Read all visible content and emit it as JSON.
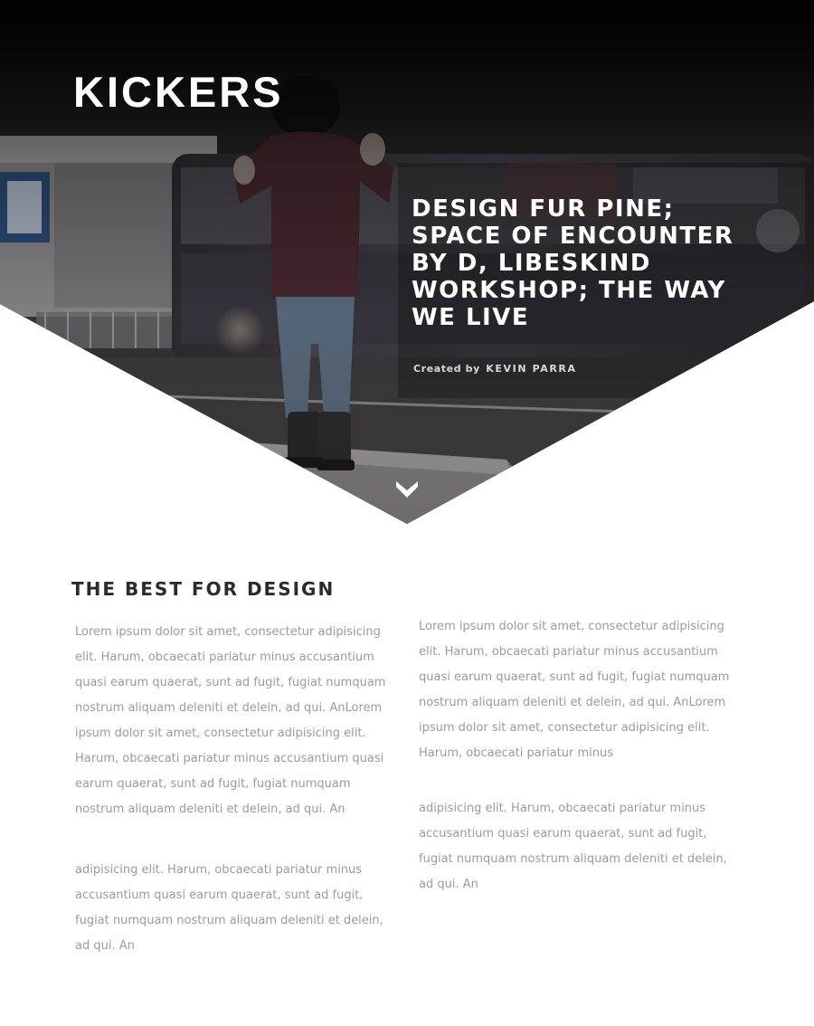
{
  "hero": {
    "brand": "KICKERS",
    "headline": "DESIGN FUR PINE; SPACE OF ENCOUNTER BY D, LIBESKIND WORKSHOP; THE WAY WE LIVE",
    "credit_prefix": "Created by",
    "credit_author": "KEVIN PARRA",
    "scroll_icon": "chevron-down-icon"
  },
  "section": {
    "title": "THE BEST FOR DESIGN",
    "left_column": [
      "Lorem ipsum dolor sit amet, consectetur adipisicing elit. Harum, obcaecati pariatur minus accusantium quasi earum quaerat, sunt ad fugit, fugiat numquam nostrum aliquam deleniti et delein, ad qui. AnLorem ipsum dolor sit amet, consectetur adipisicing elit. Harum, obcaecati pariatur minus accusantium quasi earum quaerat, sunt ad fugit, fugiat numquam nostrum aliquam deleniti et delein, ad qui. An",
      "adipisicing elit. Harum, obcaecati pariatur minus accusantium quasi earum quaerat, sunt ad fugit, fugiat numquam nostrum aliquam deleniti et delein, ad qui. An"
    ],
    "right_column": [
      "Lorem ipsum dolor sit amet, consectetur adipisicing elit. Harum, obcaecati pariatur minus accusantium quasi earum quaerat, sunt ad fugit, fugiat numquam nostrum aliquam deleniti et delein, ad qui. AnLorem ipsum dolor sit amet, consectetur adipisicing elit. Harum, obcaecati pariatur minus",
      "adipisicing elit. Harum, obcaecati pariatur minus accusantium quasi earum quaerat, sunt ad fugit, fugiat numquam nostrum aliquam deleniti et delein, ad qui. An"
    ]
  },
  "colors": {
    "background": "#ffffff",
    "hero_overlay": "#2a2728",
    "title": "#2b2b2b",
    "body_text": "#9b9b9b",
    "hero_text": "#ffffff"
  }
}
